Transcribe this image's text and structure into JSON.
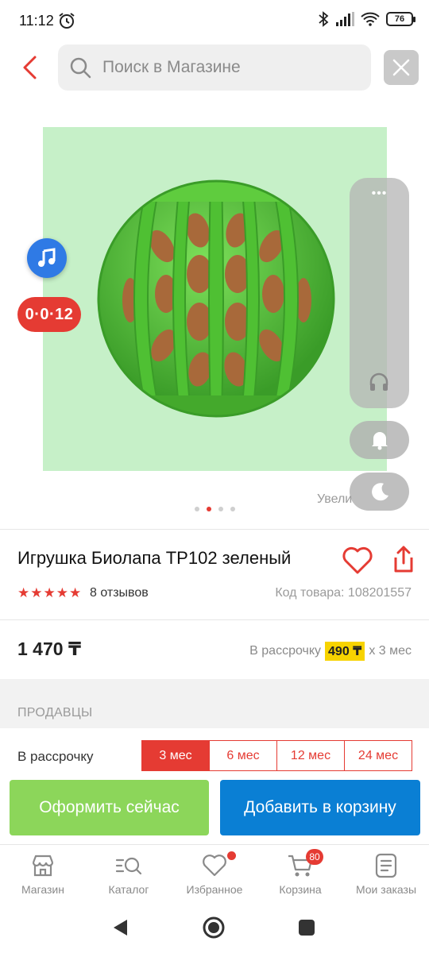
{
  "status_bar": {
    "time": "11:12",
    "battery": "76"
  },
  "search": {
    "placeholder": "Поиск в Магазине"
  },
  "overlay": {
    "timer": "0·0·12",
    "zoom_hint": "Увели"
  },
  "gallery": {
    "slides": 4,
    "active_index": 1
  },
  "product": {
    "title": "Игрушка Биолапа TP102 зеленый",
    "rating_stars": 5,
    "reviews": "8 отзывов",
    "sku": "Код товара: 108201557",
    "price": "1 470 ₸",
    "installment_prefix": "В рассрочку",
    "installment_amount": "490 ₸",
    "installment_suffix": "x 3 мес"
  },
  "sellers": {
    "heading": "ПРОДАВЦЫ"
  },
  "plan": {
    "label": "В рассрочку",
    "options": [
      "3 мес",
      "6 мес",
      "12 мес",
      "24 мес"
    ],
    "selected": "3 мес"
  },
  "actions": {
    "buy_now": "Оформить сейчас",
    "add_to_cart": "Добавить в корзину"
  },
  "bottom_nav": {
    "items": [
      {
        "label": "Магазин",
        "icon": "shop-icon"
      },
      {
        "label": "Каталог",
        "icon": "catalog-search-icon"
      },
      {
        "label": "Избранное",
        "icon": "heart-icon"
      },
      {
        "label": "Корзина",
        "icon": "cart-icon",
        "badge": "80"
      },
      {
        "label": "Мои заказы",
        "icon": "orders-icon"
      }
    ]
  },
  "colors": {
    "accent": "#e53b33",
    "buy_green": "#8cd65a",
    "cart_blue": "#0a7fd4",
    "highlight": "#f7d300"
  }
}
